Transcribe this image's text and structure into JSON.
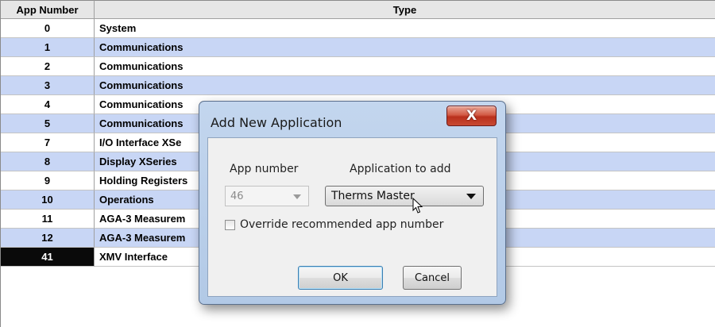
{
  "table": {
    "headers": {
      "app_number": "App Number",
      "type": "Type"
    },
    "rows": [
      {
        "num": "0",
        "type": "System"
      },
      {
        "num": "1",
        "type": "Communications"
      },
      {
        "num": "2",
        "type": "Communications"
      },
      {
        "num": "3",
        "type": "Communications"
      },
      {
        "num": "4",
        "type": "Communications"
      },
      {
        "num": "5",
        "type": "Communications"
      },
      {
        "num": "7",
        "type": "I/O Interface XSe"
      },
      {
        "num": "8",
        "type": "Display XSeries"
      },
      {
        "num": "9",
        "type": "Holding Registers"
      },
      {
        "num": "10",
        "type": "Operations"
      },
      {
        "num": "11",
        "type": "AGA-3 Measurem"
      },
      {
        "num": "12",
        "type": "AGA-3 Measurem"
      },
      {
        "num": "41",
        "type": "XMV Interface"
      }
    ]
  },
  "dialog": {
    "title": "Add New Application",
    "close_glyph": "X",
    "app_number_label": "App number",
    "app_number_value": "46",
    "application_label": "Application to add",
    "application_value": "Therms Master",
    "override_label": "Override recommended app number",
    "override_checked": false,
    "ok_label": "OK",
    "cancel_label": "Cancel"
  },
  "colors": {
    "row_blue": "#c8d6f5",
    "selected_num_bg": "#0a0a0a",
    "close_red": "#c84a33"
  }
}
